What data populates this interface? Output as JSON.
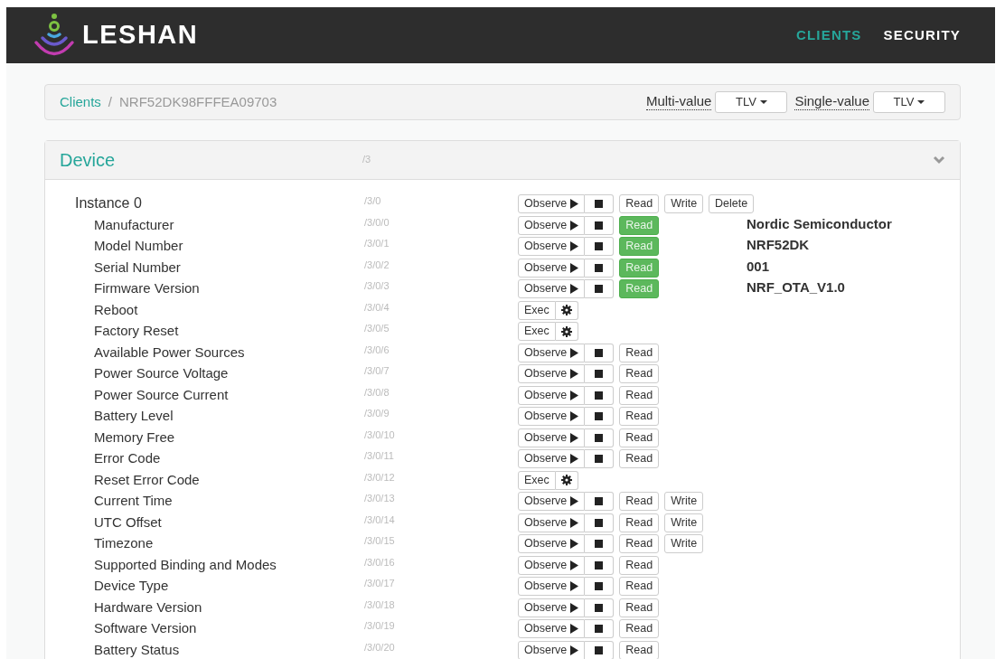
{
  "navbar": {
    "brand": "LESHAN",
    "links": [
      {
        "label": "CLIENTS",
        "selected": true
      },
      {
        "label": "SECURITY",
        "selected": false
      }
    ]
  },
  "breadcrumb": {
    "separator": "/",
    "items": [
      {
        "label": "Clients",
        "kind": "link"
      },
      {
        "label": "NRF52DK98FFFEA09703",
        "kind": "current"
      }
    ]
  },
  "formats": [
    {
      "label": "Multi-value",
      "value": "TLV"
    },
    {
      "label": "Single-value",
      "value": "TLV"
    }
  ],
  "object": {
    "title": "Device",
    "path": "/3",
    "expanded": true,
    "instance": {
      "name": "Instance 0",
      "path": "/3/0",
      "buttons": [
        "Observe",
        "Read",
        "Write",
        "Delete"
      ]
    },
    "resources": [
      {
        "name": "Manufacturer",
        "path": "/3/0/0",
        "kind": "read",
        "buttons": [
          "Observe",
          "Read"
        ],
        "read_success": true,
        "value": "Nordic Semiconductor"
      },
      {
        "name": "Model Number",
        "path": "/3/0/1",
        "kind": "read",
        "buttons": [
          "Observe",
          "Read"
        ],
        "read_success": true,
        "value": "NRF52DK"
      },
      {
        "name": "Serial Number",
        "path": "/3/0/2",
        "kind": "read",
        "buttons": [
          "Observe",
          "Read"
        ],
        "read_success": true,
        "value": "001"
      },
      {
        "name": "Firmware Version",
        "path": "/3/0/3",
        "kind": "read",
        "buttons": [
          "Observe",
          "Read"
        ],
        "read_success": true,
        "value": "NRF_OTA_V1.0"
      },
      {
        "name": "Reboot",
        "path": "/3/0/4",
        "kind": "exec",
        "buttons": [
          "Exec"
        ]
      },
      {
        "name": "Factory Reset",
        "path": "/3/0/5",
        "kind": "exec",
        "buttons": [
          "Exec"
        ]
      },
      {
        "name": "Available Power Sources",
        "path": "/3/0/6",
        "kind": "read",
        "buttons": [
          "Observe",
          "Read"
        ],
        "read_success": false
      },
      {
        "name": "Power Source Voltage",
        "path": "/3/0/7",
        "kind": "read",
        "buttons": [
          "Observe",
          "Read"
        ],
        "read_success": false
      },
      {
        "name": "Power Source Current",
        "path": "/3/0/8",
        "kind": "read",
        "buttons": [
          "Observe",
          "Read"
        ],
        "read_success": false
      },
      {
        "name": "Battery Level",
        "path": "/3/0/9",
        "kind": "read",
        "buttons": [
          "Observe",
          "Read"
        ],
        "read_success": false
      },
      {
        "name": "Memory Free",
        "path": "/3/0/10",
        "kind": "read",
        "buttons": [
          "Observe",
          "Read"
        ],
        "read_success": false
      },
      {
        "name": "Error Code",
        "path": "/3/0/11",
        "kind": "read",
        "buttons": [
          "Observe",
          "Read"
        ],
        "read_success": false
      },
      {
        "name": "Reset Error Code",
        "path": "/3/0/12",
        "kind": "exec",
        "buttons": [
          "Exec"
        ]
      },
      {
        "name": "Current Time",
        "path": "/3/0/13",
        "kind": "readwrite",
        "buttons": [
          "Observe",
          "Read",
          "Write"
        ],
        "read_success": false
      },
      {
        "name": "UTC Offset",
        "path": "/3/0/14",
        "kind": "readwrite",
        "buttons": [
          "Observe",
          "Read",
          "Write"
        ],
        "read_success": false
      },
      {
        "name": "Timezone",
        "path": "/3/0/15",
        "kind": "readwrite",
        "buttons": [
          "Observe",
          "Read",
          "Write"
        ],
        "read_success": false
      },
      {
        "name": "Supported Binding and Modes",
        "path": "/3/0/16",
        "kind": "read",
        "buttons": [
          "Observe",
          "Read"
        ],
        "read_success": false
      },
      {
        "name": "Device Type",
        "path": "/3/0/17",
        "kind": "read",
        "buttons": [
          "Observe",
          "Read"
        ],
        "read_success": false
      },
      {
        "name": "Hardware Version",
        "path": "/3/0/18",
        "kind": "read",
        "buttons": [
          "Observe",
          "Read"
        ],
        "read_success": false
      },
      {
        "name": "Software Version",
        "path": "/3/0/19",
        "kind": "read",
        "buttons": [
          "Observe",
          "Read"
        ],
        "read_success": false
      },
      {
        "name": "Battery Status",
        "path": "/3/0/20",
        "kind": "read",
        "buttons": [
          "Observe",
          "Read"
        ],
        "read_success": false
      }
    ]
  }
}
